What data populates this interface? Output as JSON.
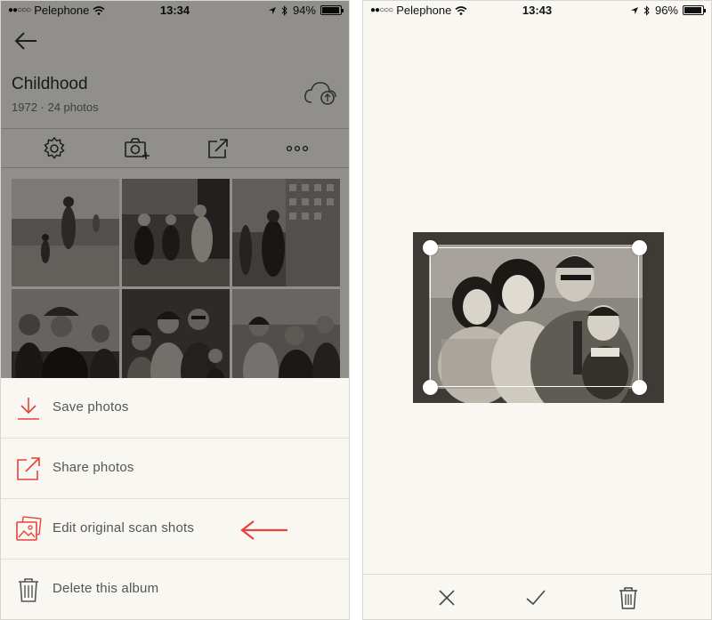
{
  "left_screen": {
    "status_bar": {
      "carrier": "Pelephone",
      "time": "13:34",
      "battery": "94%",
      "battery_level": 0.94
    },
    "album": {
      "title": "Childhood",
      "subtitle": "1972 · 24 photos"
    },
    "toolbar": {
      "icons": [
        "gear-icon",
        "camera-add-icon",
        "share-icon",
        "more-icon"
      ]
    },
    "action_sheet": {
      "items": [
        {
          "label": "Save photos",
          "icon": "download-icon"
        },
        {
          "label": "Share photos",
          "icon": "share-icon"
        },
        {
          "label": "Edit original scan shots",
          "icon": "photos-stack-icon"
        },
        {
          "label": "Delete this album",
          "icon": "trash-icon"
        }
      ]
    },
    "annotation_arrow_color": "#e8423a"
  },
  "right_screen": {
    "status_bar": {
      "carrier": "Pelephone",
      "time": "13:43",
      "battery": "96%",
      "battery_level": 0.96
    },
    "bottom_bar": {
      "icons": [
        "close-icon",
        "check-icon",
        "trash-icon"
      ]
    }
  },
  "colors": {
    "accent": "#e8423a",
    "background": "#f8f7f2",
    "icon_dark": "#3a3a3a"
  }
}
